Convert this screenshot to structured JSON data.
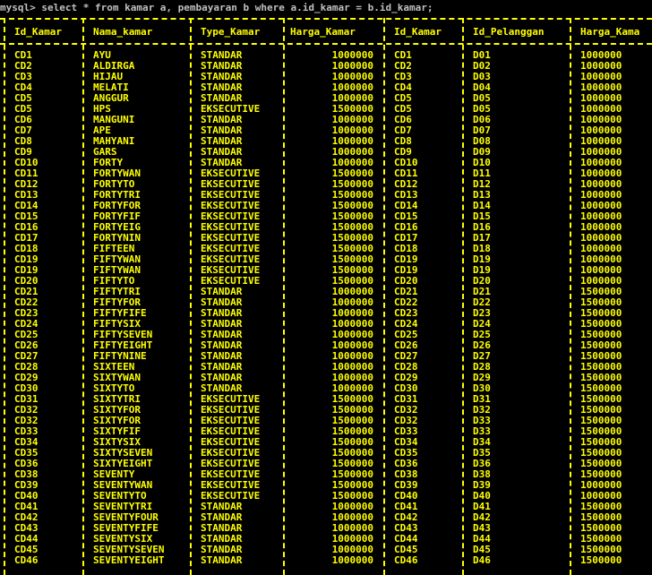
{
  "window": {
    "prompt": "mysql> select * from kamar a, pembayaran b where a.id_kamar = b.id_kamar;"
  },
  "colors": {
    "background": "#000000",
    "text": "#ffff00",
    "prompt": "#c0c0c0"
  },
  "table": {
    "columns": [
      "Id_Kamar",
      "Nama_kamar",
      "Type_Kamar",
      "Harga_Kamar",
      "Id_Kamar",
      "Id_Pelanggan",
      "Harga_Kama"
    ],
    "rows": [
      [
        "CD1",
        "AYU",
        "STANDAR",
        "1000000",
        "CD1",
        "D01",
        "1000000"
      ],
      [
        "CD2",
        "ALDIRGA",
        "STANDAR",
        "1000000",
        "CD2",
        "D02",
        "1000000"
      ],
      [
        "CD3",
        "HIJAU",
        "STANDAR",
        "1000000",
        "CD3",
        "D03",
        "1000000"
      ],
      [
        "CD4",
        "MELATI",
        "STANDAR",
        "1000000",
        "CD4",
        "D04",
        "1000000"
      ],
      [
        "CD5",
        "ANGGUR",
        "STANDAR",
        "1000000",
        "CD5",
        "D05",
        "1000000"
      ],
      [
        "CD5",
        "HPS",
        "EKSECUTIVE",
        "1500000",
        "CD5",
        "D05",
        "1000000"
      ],
      [
        "CD6",
        "MANGUNI",
        "STANDAR",
        "1000000",
        "CD6",
        "D06",
        "1000000"
      ],
      [
        "CD7",
        "APE",
        "STANDAR",
        "1000000",
        "CD7",
        "D07",
        "1000000"
      ],
      [
        "CD8",
        "MAHYANI",
        "STANDAR",
        "1000000",
        "CD8",
        "D08",
        "1000000"
      ],
      [
        "CD9",
        "GARS",
        "STANDAR",
        "1000000",
        "CD9",
        "D09",
        "1000000"
      ],
      [
        "CD10",
        "FORTY",
        "STANDAR",
        "1000000",
        "CD10",
        "D10",
        "1000000"
      ],
      [
        "CD11",
        "FORTYWAN",
        "EKSECUTIVE",
        "1500000",
        "CD11",
        "D11",
        "1000000"
      ],
      [
        "CD12",
        "FORTYTO",
        "EKSECUTIVE",
        "1500000",
        "CD12",
        "D12",
        "1000000"
      ],
      [
        "CD13",
        "FORTYTRI",
        "EKSECUTIVE",
        "1500000",
        "CD13",
        "D13",
        "1000000"
      ],
      [
        "CD14",
        "FORTYFOR",
        "EKSECUTIVE",
        "1500000",
        "CD14",
        "D14",
        "1000000"
      ],
      [
        "CD15",
        "FORTYFIF",
        "EKSECUTIVE",
        "1500000",
        "CD15",
        "D15",
        "1000000"
      ],
      [
        "CD16",
        "FORTYEIG",
        "EKSECUTIVE",
        "1500000",
        "CD16",
        "D16",
        "1000000"
      ],
      [
        "CD17",
        "FORTYNIN",
        "EKSECUTIVE",
        "1500000",
        "CD17",
        "D17",
        "1000000"
      ],
      [
        "CD18",
        "FIFTEEN",
        "EKSECUTIVE",
        "1500000",
        "CD18",
        "D18",
        "1000000"
      ],
      [
        "CD19",
        "FIFTYWAN",
        "EKSECUTIVE",
        "1500000",
        "CD19",
        "D19",
        "1000000"
      ],
      [
        "CD19",
        "FIFTYWAN",
        "EKSECUTIVE",
        "1500000",
        "CD19",
        "D19",
        "1000000"
      ],
      [
        "CD20",
        "FIFTYTO",
        "EKSECUTIVE",
        "1500000",
        "CD20",
        "D20",
        "1000000"
      ],
      [
        "CD21",
        "FIFTYTRI",
        "STANDAR",
        "1000000",
        "CD21",
        "D21",
        "1500000"
      ],
      [
        "CD22",
        "FIFTYFOR",
        "STANDAR",
        "1000000",
        "CD22",
        "D22",
        "1500000"
      ],
      [
        "CD23",
        "FIFTYFIFE",
        "STANDAR",
        "1000000",
        "CD23",
        "D23",
        "1500000"
      ],
      [
        "CD24",
        "FIFTYSIX",
        "STANDAR",
        "1000000",
        "CD24",
        "D24",
        "1500000"
      ],
      [
        "CD25",
        "FIFTYSEVEN",
        "STANDAR",
        "1000000",
        "CD25",
        "D25",
        "1500000"
      ],
      [
        "CD26",
        "FIFTYEIGHT",
        "STANDAR",
        "1000000",
        "CD26",
        "D26",
        "1500000"
      ],
      [
        "CD27",
        "FIFTYNINE",
        "STANDAR",
        "1000000",
        "CD27",
        "D27",
        "1500000"
      ],
      [
        "CD28",
        "SIXTEEN",
        "STANDAR",
        "1000000",
        "CD28",
        "D28",
        "1500000"
      ],
      [
        "CD29",
        "SIXTYWAN",
        "STANDAR",
        "1000000",
        "CD29",
        "D29",
        "1500000"
      ],
      [
        "CD30",
        "SIXTYTO",
        "STANDAR",
        "1000000",
        "CD30",
        "D30",
        "1500000"
      ],
      [
        "CD31",
        "SIXTYTRI",
        "EKSECUTIVE",
        "1500000",
        "CD31",
        "D31",
        "1500000"
      ],
      [
        "CD32",
        "SIXTYFOR",
        "EKSECUTIVE",
        "1500000",
        "CD32",
        "D32",
        "1500000"
      ],
      [
        "CD32",
        "SIXTYFOR",
        "EKSECUTIVE",
        "1500000",
        "CD32",
        "D33",
        "1500000"
      ],
      [
        "CD33",
        "SIXTYFIF",
        "EKSECUTIVE",
        "1500000",
        "CD33",
        "D33",
        "1500000"
      ],
      [
        "CD34",
        "SIXTYSIX",
        "EKSECUTIVE",
        "1500000",
        "CD34",
        "D34",
        "1500000"
      ],
      [
        "CD35",
        "SIXTYSEVEN",
        "EKSECUTIVE",
        "1500000",
        "CD35",
        "D35",
        "1500000"
      ],
      [
        "CD36",
        "SIXTYEIGHT",
        "EKSECUTIVE",
        "1500000",
        "CD36",
        "D36",
        "1500000"
      ],
      [
        "CD38",
        "SEVENTY",
        "EKSECUTIVE",
        "1500000",
        "CD38",
        "D38",
        "1500000"
      ],
      [
        "CD39",
        "SEVENTYWAN",
        "EKSECUTIVE",
        "1500000",
        "CD39",
        "D39",
        "1000000"
      ],
      [
        "CD40",
        "SEVENTYTO",
        "EKSECUTIVE",
        "1500000",
        "CD40",
        "D40",
        "1000000"
      ],
      [
        "CD41",
        "SEVENTYTRI",
        "STANDAR",
        "1000000",
        "CD41",
        "D41",
        "1500000"
      ],
      [
        "CD42",
        "SEVENTYFOUR",
        "STANDAR",
        "1000000",
        "CD42",
        "D42",
        "1500000"
      ],
      [
        "CD43",
        "SEVENTYFIFE",
        "STANDAR",
        "1000000",
        "CD43",
        "D43",
        "1500000"
      ],
      [
        "CD44",
        "SEVENTYSIX",
        "STANDAR",
        "1000000",
        "CD44",
        "D44",
        "1500000"
      ],
      [
        "CD45",
        "SEVENTYSEVEN",
        "STANDAR",
        "1000000",
        "CD45",
        "D45",
        "1500000"
      ],
      [
        "CD46",
        "SEVENTYEIGHT",
        "STANDAR",
        "1000000",
        "CD46",
        "D46",
        "1500000"
      ]
    ]
  }
}
